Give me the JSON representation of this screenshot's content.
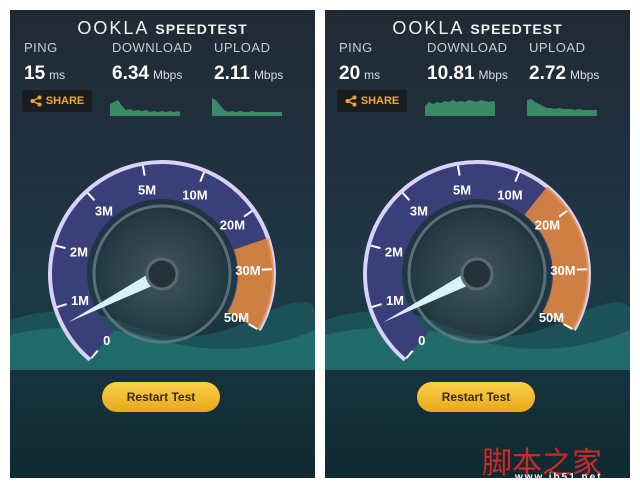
{
  "colors": {
    "accent": "#f0a830",
    "button": "#f2bd38",
    "gauge_arc": "#8b7fd0",
    "gauge_highlight": "#e98b3a"
  },
  "panels": [
    {
      "logo_brand": "OOKLA",
      "logo_product": "SPEEDTEST",
      "ping": {
        "label": "PING",
        "value": "15",
        "unit": "ms"
      },
      "download": {
        "label": "DOWNLOAD",
        "value": "6.34",
        "unit": "Mbps"
      },
      "upload": {
        "label": "UPLOAD",
        "value": "2.11",
        "unit": "Mbps"
      },
      "share_label": "SHARE",
      "share_icon": "share-icon",
      "gauge_ticks": [
        "0",
        "1M",
        "2M",
        "3M",
        "5M",
        "10M",
        "20M",
        "30M",
        "50M"
      ],
      "gauge_filled_segments": 6.5,
      "needle_mbps": 0.7,
      "restart_label": "Restart Test"
    },
    {
      "logo_brand": "OOKLA",
      "logo_product": "SPEEDTEST",
      "ping": {
        "label": "PING",
        "value": "20",
        "unit": "ms"
      },
      "download": {
        "label": "DOWNLOAD",
        "value": "10.81",
        "unit": "Mbps"
      },
      "upload": {
        "label": "UPLOAD",
        "value": "2.72",
        "unit": "Mbps"
      },
      "share_label": "SHARE",
      "share_icon": "share-icon",
      "gauge_ticks": [
        "0",
        "1M",
        "2M",
        "3M",
        "5M",
        "10M",
        "20M",
        "30M",
        "50M"
      ],
      "gauge_filled_segments": 5.5,
      "needle_mbps": 0.7,
      "restart_label": "Restart Test"
    }
  ],
  "watermark": {
    "text": "脚本之家",
    "url": "www.jb51.net"
  }
}
